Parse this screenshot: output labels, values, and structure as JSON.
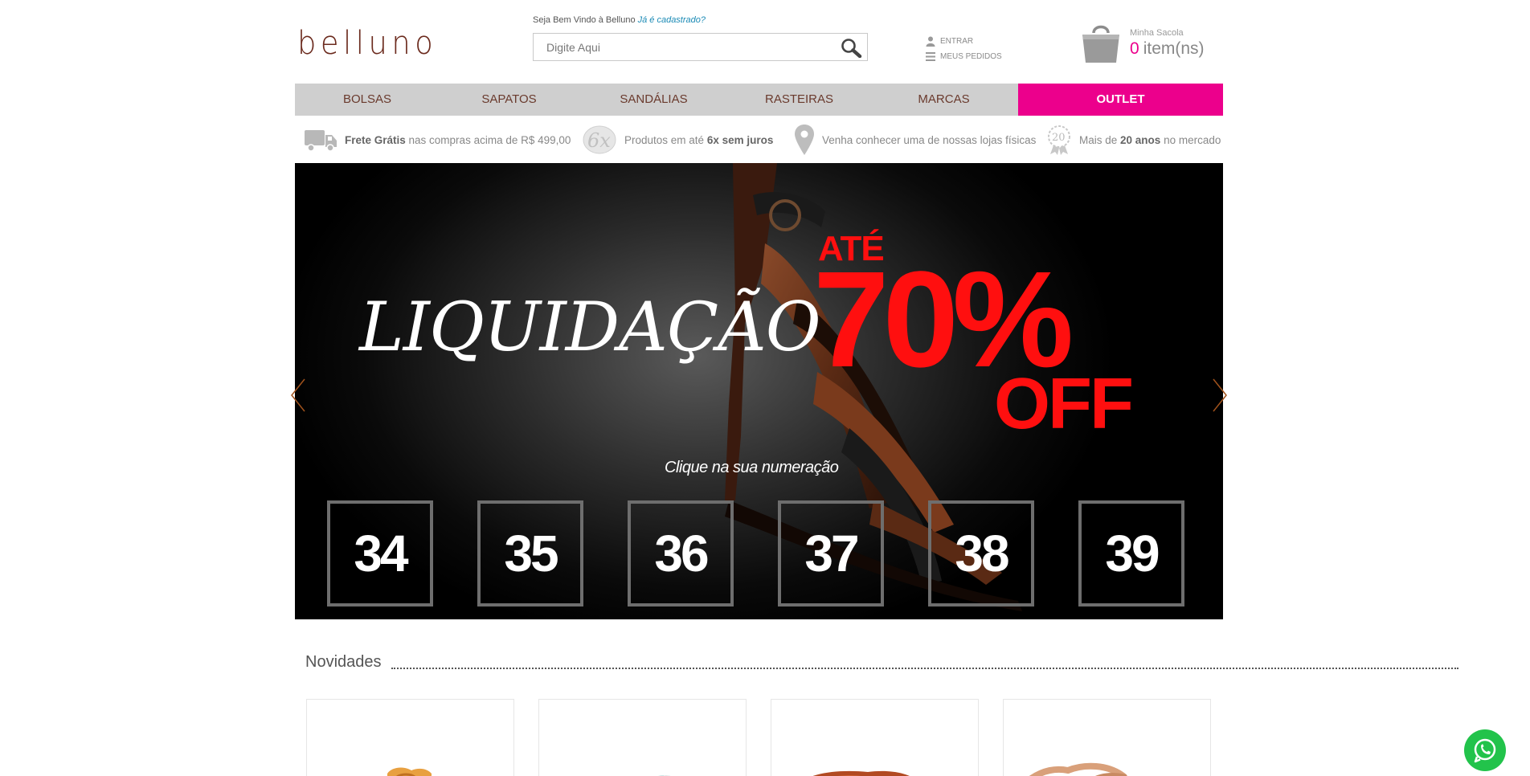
{
  "header": {
    "logo": "belluno",
    "welcome_text": "Seja Bem Vindo à Belluno",
    "registered_link": "Já é cadastrado?",
    "search_placeholder": "Digite Aqui",
    "account": {
      "login": "ENTRAR",
      "orders": "MEUS PEDIDOS"
    },
    "cart": {
      "label": "Minha Sacola",
      "count": "0",
      "unit": "item(ns)"
    }
  },
  "nav": {
    "items": [
      {
        "label": "BOLSAS"
      },
      {
        "label": "SAPATOS"
      },
      {
        "label": "SANDÁLIAS"
      },
      {
        "label": "RASTEIRAS"
      },
      {
        "label": "MARCAS"
      },
      {
        "label": "OUTLET"
      }
    ]
  },
  "benefits": [
    {
      "icon": "truck-icon",
      "bold": "Frete Grátis",
      "text": " nas compras acima de R$ 499,00"
    },
    {
      "icon": "6x-badge-icon",
      "badge": "6x",
      "text": "Produtos em até ",
      "bold": "6x sem juros"
    },
    {
      "icon": "map-pin-icon",
      "text": "Venha conhecer uma de nossas lojas físicas"
    },
    {
      "icon": "award-20-icon",
      "badge": "20",
      "text": "Mais de ",
      "bold": "20 anos",
      "text2": " no mercado"
    }
  ],
  "banner": {
    "title": "LIQUIDAÇÃO",
    "ate": "ATÉ",
    "percent": "70%",
    "off": "OFF",
    "subtitle": "Clique na sua numeração",
    "sizes": [
      "34",
      "35",
      "36",
      "37",
      "38",
      "39"
    ]
  },
  "section": {
    "title": "Novidades"
  },
  "colors": {
    "brand": "#6b2a1d",
    "accent": "#ec008c",
    "sale_red": "#ff0f0f",
    "whatsapp": "#22c34b"
  }
}
